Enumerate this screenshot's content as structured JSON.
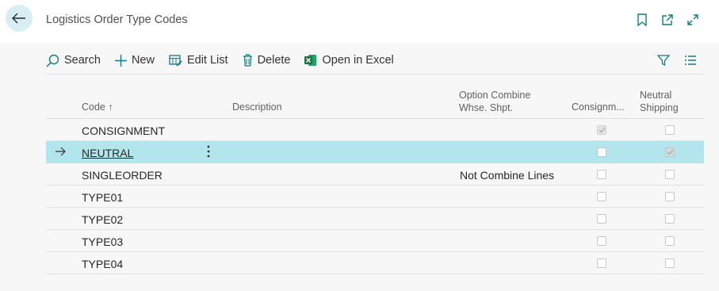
{
  "header": {
    "title": "Logistics Order Type Codes",
    "icons": [
      "back-arrow-icon",
      "bookmark-icon",
      "open-new-window-icon",
      "expand-icon"
    ]
  },
  "toolbar": {
    "search_label": "Search",
    "new_label": "New",
    "edit_list_label": "Edit List",
    "delete_label": "Delete",
    "open_excel_label": "Open in Excel"
  },
  "columns": {
    "code": "Code ↑",
    "description": "Description",
    "option_line1": "Option Combine",
    "option_line2": "Whse. Shpt.",
    "consignment": "Consignm...",
    "neutral_line1": "Neutral",
    "neutral_line2": "Shipping"
  },
  "rows": [
    {
      "code": "CONSIGNMENT",
      "description": "",
      "option": "",
      "consignment": true,
      "neutral": false
    },
    {
      "code": "NEUTRAL",
      "description": "",
      "option": "",
      "consignment": false,
      "neutral": true
    },
    {
      "code": "SINGLEORDER",
      "description": "",
      "option": "Not Combine Lines",
      "consignment": false,
      "neutral": false
    },
    {
      "code": "TYPE01",
      "description": "",
      "option": "",
      "consignment": false,
      "neutral": false
    },
    {
      "code": "TYPE02",
      "description": "",
      "option": "",
      "consignment": false,
      "neutral": false
    },
    {
      "code": "TYPE03",
      "description": "",
      "option": "",
      "consignment": false,
      "neutral": false
    },
    {
      "code": "TYPE04",
      "description": "",
      "option": "",
      "consignment": false,
      "neutral": false
    }
  ],
  "selected_row": "NEUTRAL",
  "colors": {
    "accent": "#0f7b83",
    "selected_row": "#b2e6ec",
    "excel_green": "#1e7145"
  }
}
